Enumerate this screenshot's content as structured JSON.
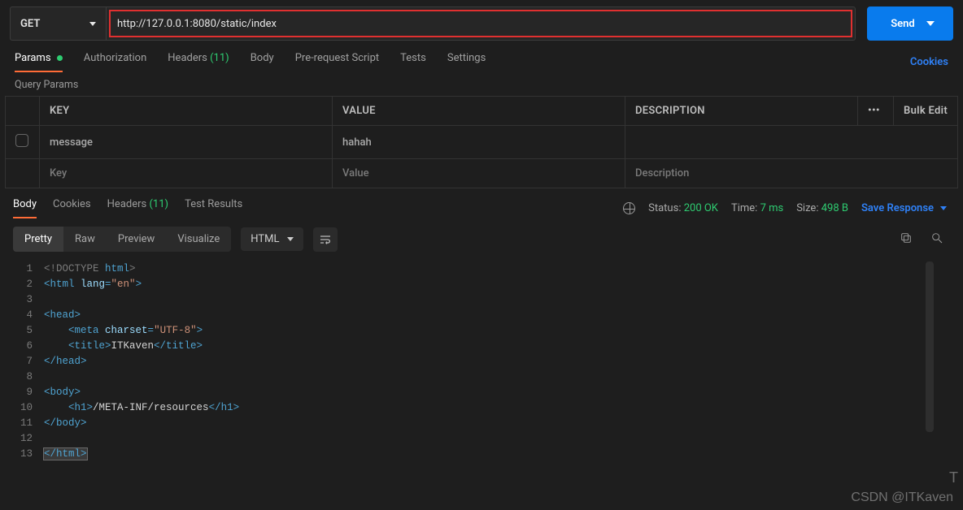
{
  "request": {
    "method": "GET",
    "url": "http://127.0.0.1:8080/static/index",
    "send_label": "Send"
  },
  "req_tabs": {
    "params": "Params",
    "authorization": "Authorization",
    "headers": "Headers",
    "headers_count": "(11)",
    "body": "Body",
    "prerequest": "Pre-request Script",
    "tests": "Tests",
    "settings": "Settings",
    "cookies": "Cookies"
  },
  "query_params": {
    "title": "Query Params",
    "cols": {
      "key": "KEY",
      "value": "VALUE",
      "desc": "DESCRIPTION",
      "bulk": "Bulk Edit"
    },
    "rows": [
      {
        "key": "message",
        "value": "hahah",
        "desc": ""
      }
    ],
    "placeholders": {
      "key": "Key",
      "value": "Value",
      "desc": "Description"
    }
  },
  "resp_tabs": {
    "body": "Body",
    "cookies": "Cookies",
    "headers": "Headers",
    "headers_count": "(11)",
    "test_results": "Test Results"
  },
  "response_meta": {
    "status_label": "Status:",
    "status_value": "200 OK",
    "time_label": "Time:",
    "time_value": "7 ms",
    "size_label": "Size:",
    "size_value": "498 B",
    "save": "Save Response"
  },
  "view": {
    "pretty": "Pretty",
    "raw": "Raw",
    "preview": "Preview",
    "visualize": "Visualize",
    "format": "HTML"
  },
  "code_lines": [
    {
      "n": 1,
      "seg": [
        [
          "t-doctype",
          "<!DOCTYPE "
        ],
        [
          "t-tag",
          "html"
        ],
        [
          "t-doctype",
          ">"
        ]
      ]
    },
    {
      "n": 2,
      "seg": [
        [
          "t-tag",
          "<html "
        ],
        [
          "t-attr",
          "lang"
        ],
        [
          "t-tag",
          "="
        ],
        [
          "t-str",
          "\"en\""
        ],
        [
          "t-tag",
          ">"
        ]
      ]
    },
    {
      "n": 3,
      "seg": []
    },
    {
      "n": 4,
      "seg": [
        [
          "t-tag",
          "<head>"
        ]
      ]
    },
    {
      "n": 5,
      "seg": [
        [
          "t-txt",
          "    "
        ],
        [
          "t-tag",
          "<meta "
        ],
        [
          "t-attr",
          "charset"
        ],
        [
          "t-tag",
          "="
        ],
        [
          "t-str",
          "\"UTF-8\""
        ],
        [
          "t-tag",
          ">"
        ]
      ]
    },
    {
      "n": 6,
      "seg": [
        [
          "t-txt",
          "    "
        ],
        [
          "t-tag",
          "<title>"
        ],
        [
          "t-txt",
          "ITKaven"
        ],
        [
          "t-tag",
          "</title>"
        ]
      ]
    },
    {
      "n": 7,
      "seg": [
        [
          "t-tag",
          "</head>"
        ]
      ]
    },
    {
      "n": 8,
      "seg": []
    },
    {
      "n": 9,
      "seg": [
        [
          "t-tag",
          "<body>"
        ]
      ]
    },
    {
      "n": 10,
      "seg": [
        [
          "t-txt",
          "    "
        ],
        [
          "t-tag",
          "<h1>"
        ],
        [
          "t-txt",
          "/META-INF/resources"
        ],
        [
          "t-tag",
          "</h1>"
        ]
      ]
    },
    {
      "n": 11,
      "seg": [
        [
          "t-tag",
          "</body>"
        ]
      ]
    },
    {
      "n": 12,
      "seg": []
    },
    {
      "n": 13,
      "seg": [
        [
          "cursor-hl t-tag",
          "</html>"
        ]
      ]
    }
  ],
  "watermark": "CSDN @ITKaven"
}
